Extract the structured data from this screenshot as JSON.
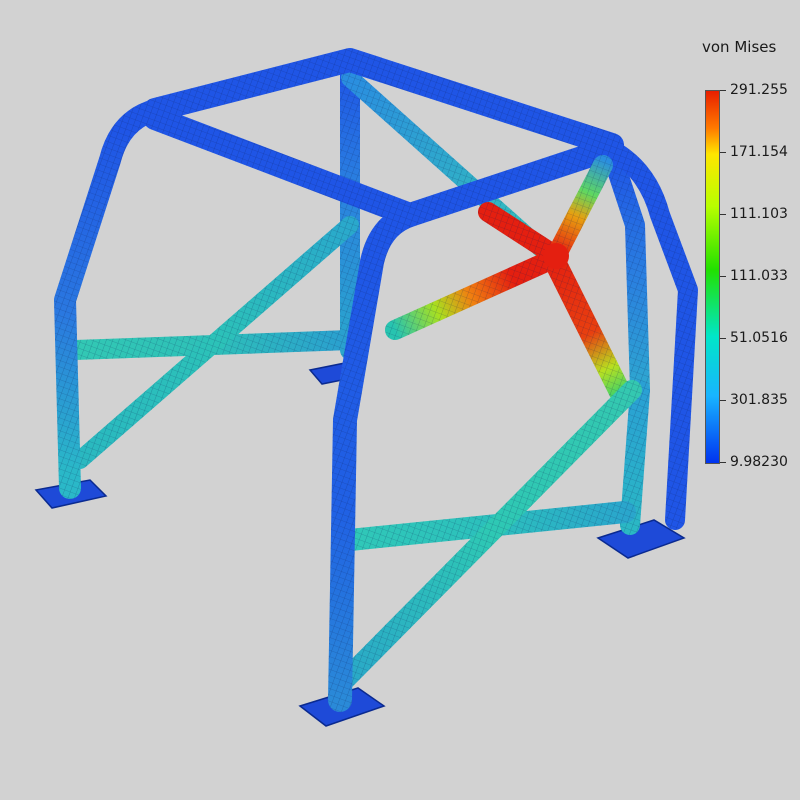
{
  "legend": {
    "title": "von Mises",
    "labels": [
      "291.255",
      "171.154",
      "111.103",
      "111.033",
      "51.0516",
      "301.835",
      "9.98230"
    ]
  },
  "colors": {
    "background": "#d2d2d2",
    "low_stress": "#1f55e6",
    "mid_stress": "#2fc8b0",
    "high_stress": "#e41f10",
    "mesh": "#0a1a50"
  }
}
